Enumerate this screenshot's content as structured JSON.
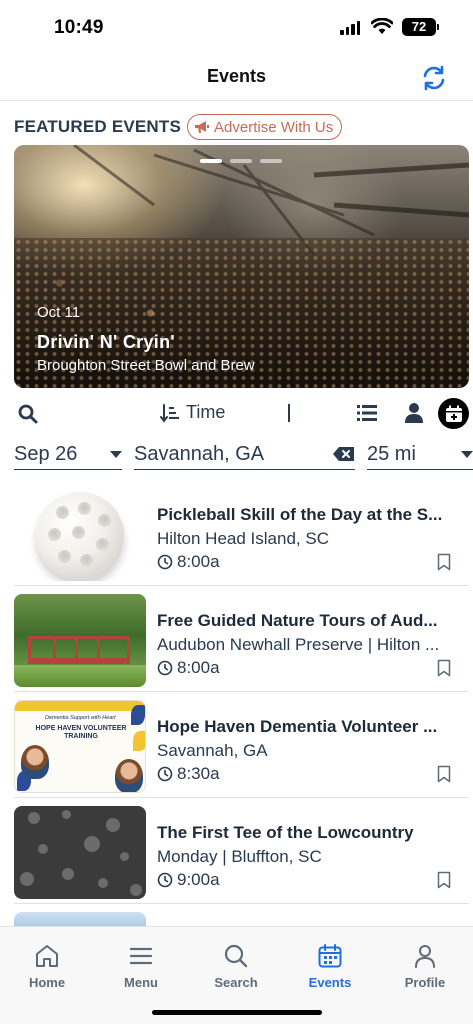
{
  "status_bar": {
    "time": "10:49",
    "battery": "72"
  },
  "nav": {
    "title": "Events"
  },
  "featured": {
    "title": "FEATURED EVENTS",
    "advertise_label": "Advertise With Us",
    "carousel": {
      "date": "Oct 11",
      "title": "Drivin' N' Cryin'",
      "venue": "Broughton Street Bowl and Brew",
      "slide_count": 3,
      "active_slide": 1
    }
  },
  "filters": {
    "sort_label": "Time",
    "date": "Sep 26",
    "location": "Savannah, GA",
    "radius": "25 mi"
  },
  "events": [
    {
      "title": "Pickleball Skill of the Day at the S...",
      "location": "Hilton Head Island, SC",
      "time": "8:00a"
    },
    {
      "title": "Free Guided Nature Tours of Aud...",
      "location": "Audubon Newhall Preserve | Hilton ...",
      "time": "8:00a"
    },
    {
      "title": "Hope Haven Dementia Volunteer ...",
      "location": "Savannah, GA",
      "time": "8:30a"
    },
    {
      "title": "The First Tee of the Lowcountry",
      "location": "Monday | Bluffton, SC",
      "time": "9:00a"
    }
  ],
  "flyer": {
    "script": "Dementia Support with Heart",
    "heading": "HOPE HAVEN VOLUNTEER TRAINING"
  },
  "tabs": [
    {
      "label": "Home",
      "icon": "home-icon"
    },
    {
      "label": "Menu",
      "icon": "menu-icon"
    },
    {
      "label": "Search",
      "icon": "search-icon"
    },
    {
      "label": "Events",
      "icon": "calendar-icon",
      "active": true
    },
    {
      "label": "Profile",
      "icon": "profile-icon"
    }
  ],
  "colors": {
    "accent": "#1f6fe0",
    "advertise": "#c96a55",
    "text": "#2a3a4f"
  }
}
